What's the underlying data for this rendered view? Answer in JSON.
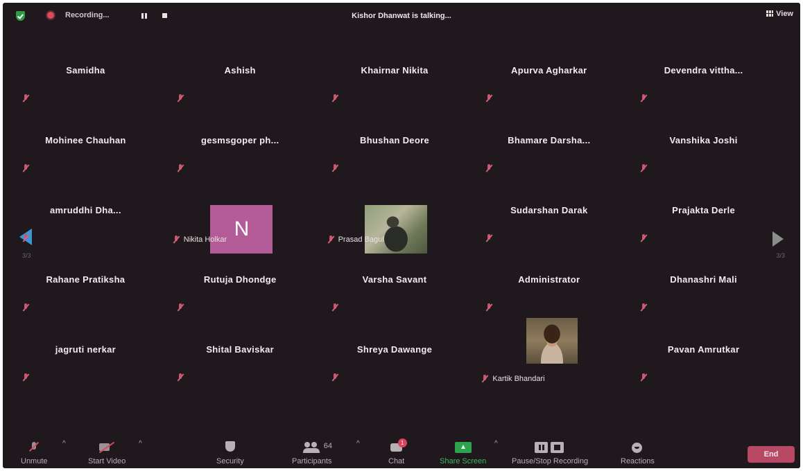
{
  "topbar": {
    "recording_label": "Recording...",
    "talking_label": "Kishor Dhanwat  is talking...",
    "view_label": "View"
  },
  "pagination": {
    "left": "3/3",
    "right": "3/3"
  },
  "participants": [
    {
      "name": "Samidha"
    },
    {
      "name": "Ashish"
    },
    {
      "name": "Khairnar Nikita"
    },
    {
      "name": "Apurva Agharkar"
    },
    {
      "name": "Devendra  vittha..."
    },
    {
      "name": "Mohinee Chauhan"
    },
    {
      "name": "gesmsgoper  ph..."
    },
    {
      "name": "Bhushan Deore"
    },
    {
      "name": "Bhamare Darsha..."
    },
    {
      "name": "Vanshika Joshi"
    },
    {
      "name": "amruddhi  Dha..."
    },
    {
      "name": "Nikita Holkar",
      "avatar_letter": "N"
    },
    {
      "name": "Prasad Bagul"
    },
    {
      "name": "Sudarshan Darak"
    },
    {
      "name": "Prajakta Derle"
    },
    {
      "name": "Rahane Pratiksha"
    },
    {
      "name": "Rutuja Dhondge"
    },
    {
      "name": "Varsha Savant"
    },
    {
      "name": "Administrator"
    },
    {
      "name": "Dhanashri Mali"
    },
    {
      "name": "jagruti nerkar"
    },
    {
      "name": "Shital Baviskar"
    },
    {
      "name": "Shreya Dawange"
    },
    {
      "name": "Kartik Bhandari"
    },
    {
      "name": "Pavan Amrutkar"
    }
  ],
  "toolbar": {
    "unmute": "Unmute",
    "start_video": "Start Video",
    "security": "Security",
    "participants": "Participants",
    "participants_count": "64",
    "chat": "Chat",
    "chat_badge": "1",
    "share_screen": "Share Screen",
    "recording": "Pause/Stop Recording",
    "reactions": "Reactions",
    "end": "End"
  },
  "colors": {
    "background": "#1f191d",
    "share_green": "#2fa24e",
    "end_button": "#b84966",
    "muted_icon": "#c9556f",
    "nav_arrow": "#3c95d6"
  }
}
